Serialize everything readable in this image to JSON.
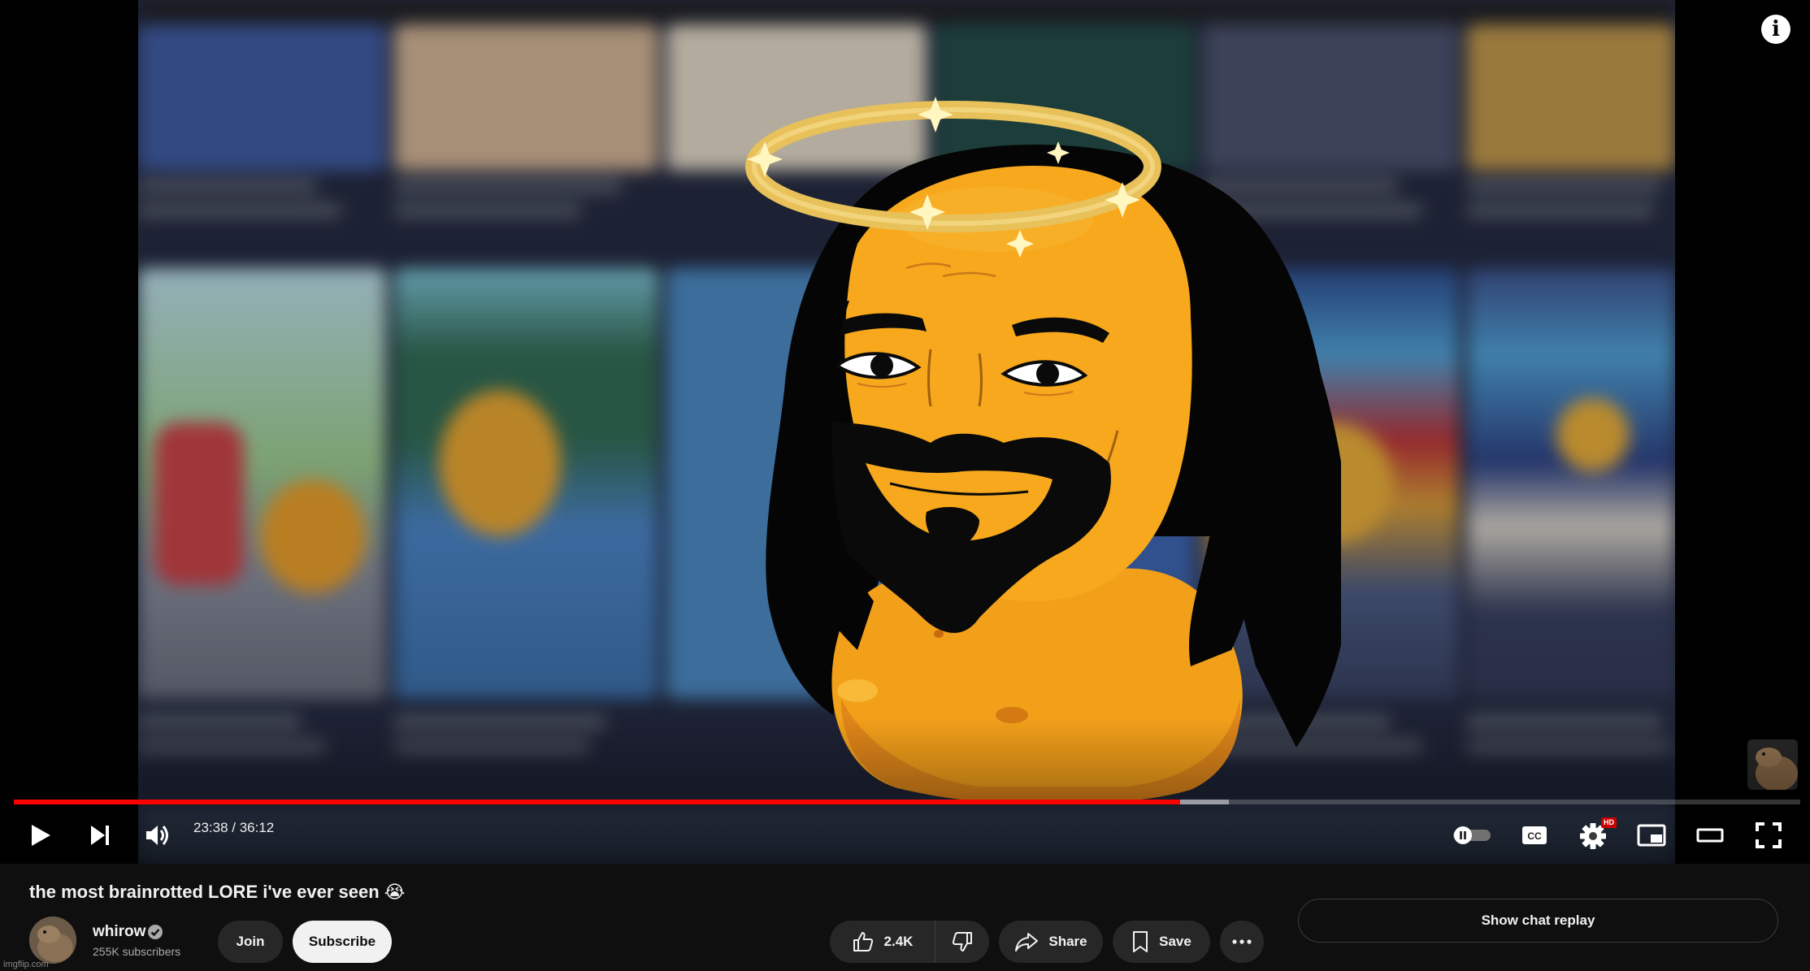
{
  "player": {
    "time_current": "23:38",
    "time_total": "36:12",
    "time_display": "23:38 / 36:12",
    "progress_fraction": 0.653,
    "buffer_fraction": 0.68,
    "hd_badge": "HD",
    "autoplay": "off",
    "icons": [
      "play-icon",
      "next-icon",
      "volume-icon",
      "autoplay-toggle-icon",
      "captions-icon",
      "settings-icon",
      "miniplayer-icon",
      "theater-icon",
      "fullscreen-icon",
      "info-icon"
    ],
    "colors": {
      "progress": "#ff0000",
      "hd_badge": "#cc0000"
    },
    "info_glyph": "i"
  },
  "video": {
    "title": "the most brainrotted LORE i've ever seen 😭"
  },
  "channel": {
    "name": "whirow",
    "subscribers": "255K subscribers",
    "verified": true
  },
  "actions": {
    "join_label": "Join",
    "subscribe_label": "Subscribe",
    "like_count": "2.4K",
    "share_label": "Share",
    "save_label": "Save",
    "more_icon": "more-horizontal-icon",
    "chat_replay_label": "Show chat replay"
  },
  "watermark": {
    "site": "imgflip.com"
  }
}
